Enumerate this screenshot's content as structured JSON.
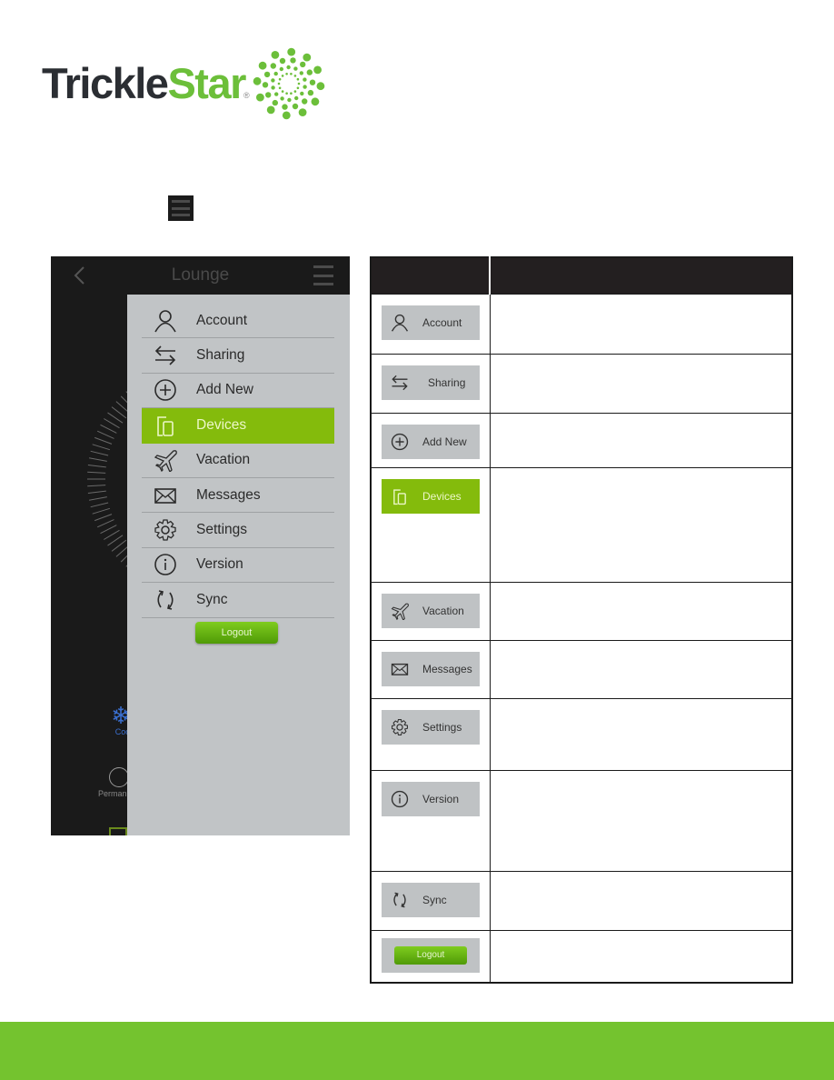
{
  "brand": {
    "name_part1": "Trickle",
    "name_part2": "Star",
    "registered_mark": "®",
    "colors": {
      "dark": "#2b2e33",
      "green": "#6cbf3a",
      "footer_green": "#74c32f"
    }
  },
  "inline_icon": "hamburger-menu-icon",
  "phone": {
    "title": "Lounge",
    "back_icon": "chevron-left-icon",
    "menu_icon": "hamburger-menu-icon",
    "background_modes": [
      {
        "icon": "snowflake-icon",
        "label": "Coo"
      },
      {
        "icon": "play-skip-circle-icon",
        "label": "Perman"
      }
    ],
    "drawer": {
      "items": [
        {
          "label": "Account",
          "icon": "user-icon",
          "active": false
        },
        {
          "label": "Sharing",
          "icon": "arrows-exchange-icon",
          "active": false
        },
        {
          "label": "Add New",
          "icon": "plus-circle-icon",
          "active": false
        },
        {
          "label": "Devices",
          "icon": "devices-icon",
          "active": true
        },
        {
          "label": "Vacation",
          "icon": "airplane-icon",
          "active": false
        },
        {
          "label": "Messages",
          "icon": "envelope-icon",
          "active": false
        },
        {
          "label": "Settings",
          "icon": "gear-icon",
          "active": false
        },
        {
          "label": "Version",
          "icon": "info-icon",
          "active": false
        },
        {
          "label": "Sync",
          "icon": "sync-icon",
          "active": false
        }
      ],
      "logout_label": "Logout",
      "active_color": "#84bb0c"
    }
  },
  "table": {
    "headers": [
      "",
      ""
    ],
    "rows": [
      {
        "label": "Account",
        "icon": "user-icon",
        "description": ""
      },
      {
        "label": "Sharing",
        "icon": "arrows-exchange-icon",
        "description": ""
      },
      {
        "label": "Add New",
        "icon": "plus-circle-icon",
        "description": ""
      },
      {
        "label": "Devices",
        "icon": "devices-icon",
        "description": ""
      },
      {
        "label": "Vacation",
        "icon": "airplane-icon",
        "description": ""
      },
      {
        "label": "Messages",
        "icon": "envelope-icon",
        "description": ""
      },
      {
        "label": "Settings",
        "icon": "gear-icon",
        "description": ""
      },
      {
        "label": "Version",
        "icon": "info-icon",
        "description": ""
      },
      {
        "label": "Sync",
        "icon": "sync-icon",
        "description": ""
      },
      {
        "label": "Logout",
        "icon": "logout-button",
        "description": ""
      }
    ]
  }
}
